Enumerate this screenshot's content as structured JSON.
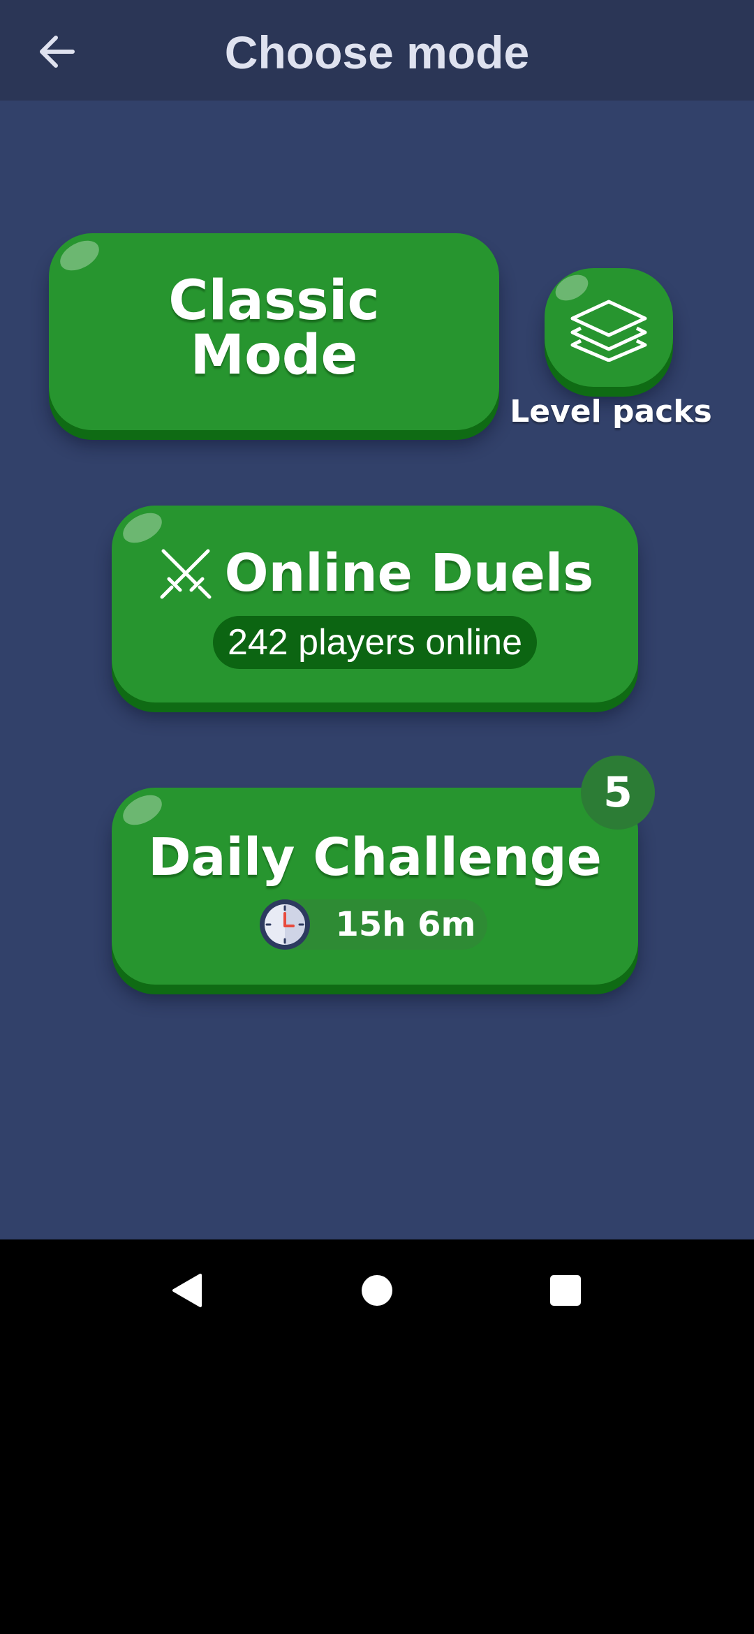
{
  "header": {
    "title": "Choose mode",
    "back_icon": "arrow-left-icon"
  },
  "modes": {
    "classic": {
      "line1": "Classic",
      "line2": "Mode"
    },
    "level_packs": {
      "label": "Level packs",
      "icon": "layers-icon"
    },
    "online_duels": {
      "label": "Online Duels",
      "players": "242 players online",
      "icon": "crossed-swords-icon"
    },
    "daily_challenge": {
      "label": "Daily Challenge",
      "timer": "15h 6m",
      "badge": "5",
      "icon": "clock-icon"
    }
  },
  "nav": {
    "back_icon": "nav-back-icon",
    "home_icon": "nav-home-icon",
    "recents_icon": "nav-recents-icon"
  },
  "colors": {
    "background": "#32416a",
    "topbar": "#2b3656",
    "button_green": "#27952f",
    "button_shadow": "#0f6b14",
    "pill_dark": "#0c6512",
    "badge": "#2c7c35"
  }
}
